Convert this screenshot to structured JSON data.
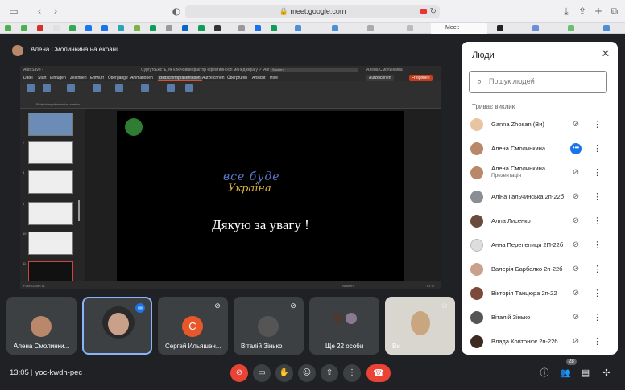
{
  "browser": {
    "url": "meet.google.com",
    "active_tab": "Meet: ·"
  },
  "presenting_banner": "Алена Смолинкина на екрані",
  "powerpoint": {
    "title": "Сургутськість, як ключовий фактор ефективності менеджера у ✓ Auf \"dmmm PC\" gespeichert",
    "search": "Suchen",
    "user": "Алена Смолинкина",
    "menu": [
      "Datei",
      "Start",
      "Einfügen",
      "Zeichnen",
      "Entwurf",
      "Übergänge",
      "Animationen",
      "Bildschirmpräsentation",
      "Aufzeichnen",
      "Überprüfen",
      "Ansicht",
      "Hilfe"
    ],
    "record_btn": "Aufzeichnen",
    "share_btn": "Freigeben",
    "ribbon_group": "Bildschirmpräsentation starten",
    "slide_numbers": [
      "7",
      "8",
      "9",
      "10",
      "11"
    ],
    "status_left": "Folie 11 von 11",
    "status_notes": "Notizen",
    "zoom": "61 %",
    "slide": {
      "script_line1": "все буде",
      "script_line2": "Україна",
      "caption": "Дякую за увагу !"
    }
  },
  "tiles": [
    {
      "name": "Алена Смолинки...",
      "muted": false
    },
    {
      "name": "Сергей Ильяшен...",
      "initial": "С",
      "muted": true
    },
    {
      "name": "Віталій Зінько",
      "muted": true
    },
    {
      "name": "Ще 22 особи"
    },
    {
      "name": "Ви",
      "muted": true
    }
  ],
  "people_panel": {
    "title": "Люди",
    "search_placeholder": "Пошук людей",
    "section": "Триває виклик",
    "participants": [
      {
        "name": "Ganna Zhosan (Ви)",
        "color": "#e8c4a0"
      },
      {
        "name": "Алена Смолинкина",
        "color": "#b9876a"
      },
      {
        "name": "Алена Смолинкина",
        "sub": "Презентація",
        "color": "#b9876a"
      },
      {
        "name": "Аліна Гальчинська 2п-22б",
        "color": "#8a8f96"
      },
      {
        "name": "Алла Лисенко",
        "color": "#6a4b3c"
      },
      {
        "name": "Анна Перепелиця 2П-22б",
        "color": "#ddd"
      },
      {
        "name": "Валерія Барбелко 2п-22б",
        "color": "#c9a08a"
      },
      {
        "name": "Вікторія Танцюра 2п-22",
        "color": "#7b4a3a"
      },
      {
        "name": "Віталій Зінько",
        "color": "#555"
      },
      {
        "name": "Влада Ковтонюк 2п-22б",
        "color": "#3d2a22"
      }
    ]
  },
  "bottom_bar": {
    "time": "13:05",
    "separator": "|",
    "code": "yoc-kwdh-pec",
    "people_count": "28"
  }
}
